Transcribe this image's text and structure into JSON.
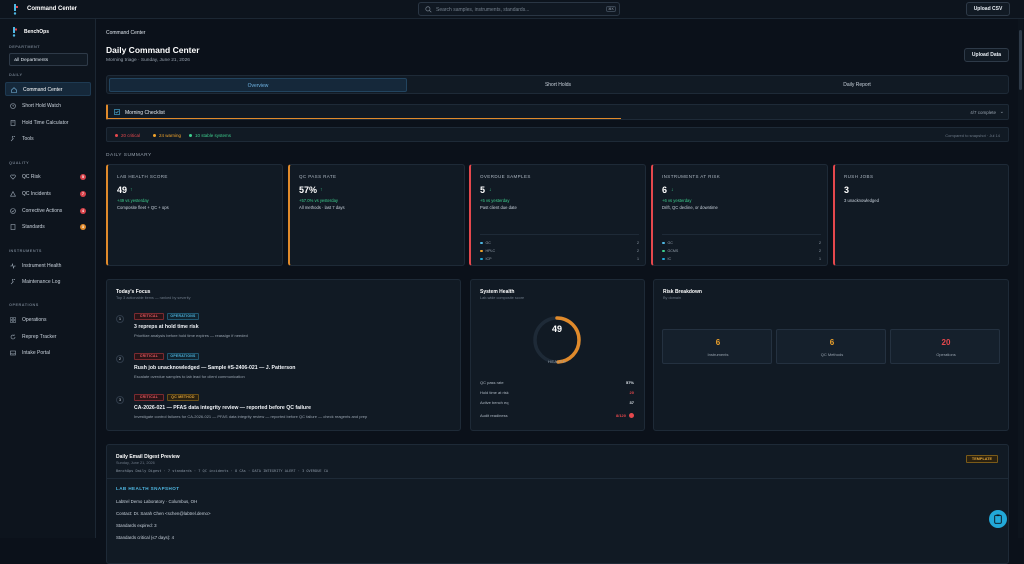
{
  "app": {
    "title": "Command Center",
    "brand": "BenchOps"
  },
  "search": {
    "placeholder": "Search samples, instruments, standards...",
    "shortcut": "⌘K"
  },
  "topbar": {
    "upload_csv": "Upload CSV"
  },
  "sidebar": {
    "department_label": "DEPARTMENT",
    "department_value": "All Departments",
    "sections": {
      "daily": "DAILY",
      "quality": "QUALITY",
      "instruments": "INSTRUMENTS",
      "operations": "OPERATIONS"
    },
    "daily_items": [
      {
        "label": "Command Center",
        "icon": "home-icon",
        "active": true
      },
      {
        "label": "Short Hold Watch",
        "icon": "clock-icon"
      },
      {
        "label": "Hold Time Calculator",
        "icon": "calculator-icon"
      },
      {
        "label": "Tools",
        "icon": "wrench-icon"
      }
    ],
    "quality_items": [
      {
        "label": "QC Risk",
        "icon": "heart-icon",
        "badge": "5",
        "badge_color": "#d8434b"
      },
      {
        "label": "QC Incidents",
        "icon": "alert-icon",
        "badge": "7",
        "badge_color": "#d8434b"
      },
      {
        "label": "Corrective Actions",
        "icon": "check-circle-icon",
        "badge": "4",
        "badge_color": "#d8434b"
      },
      {
        "label": "Standards",
        "icon": "document-icon",
        "badge": "3",
        "badge_color": "#e08a2b"
      }
    ],
    "instrument_items": [
      {
        "label": "Instrument Health",
        "icon": "pulse-icon"
      },
      {
        "label": "Maintenance Log",
        "icon": "wrench-icon"
      }
    ],
    "operation_items": [
      {
        "label": "Operations",
        "icon": "grid-icon"
      },
      {
        "label": "Reprep Tracker",
        "icon": "refresh-icon"
      },
      {
        "label": "Intake Portal",
        "icon": "inbox-icon"
      }
    ]
  },
  "main": {
    "breadcrumb": "Command Center",
    "title": "Daily Command Center",
    "subtitle": "Morning triage · Sunday, June 21, 2026",
    "upload_data": "Upload Data",
    "tabs": [
      {
        "label": "Overview",
        "active": true
      },
      {
        "label": "Short Holds"
      },
      {
        "label": "Daily Report"
      }
    ],
    "checklist": {
      "label": "Morning Checklist",
      "count": "4/7 complete",
      "progress": 0.57
    },
    "status": {
      "critical": "20 critical",
      "warning": "24 warning",
      "stable": "10 stable systems",
      "compare": "Compared to snapshot · Jul 14"
    },
    "colors": {
      "critical": "#e5484d",
      "warning": "#f0a32b",
      "stable": "#3ecf8e",
      "accent": "#22a8d8"
    },
    "summary_label": "DAILY SUMMARY"
  },
  "kpis": [
    {
      "title": "LAB HEALTH SCORE",
      "value": "49",
      "trend": "↑",
      "trend_color": "#3ecf8e",
      "delta": "+49 vs yesterday",
      "note": "Composite fleet + QC + ops",
      "accent": "#e08a2b",
      "rows": []
    },
    {
      "title": "QC PASS RATE",
      "value": "57%",
      "trend": "↑",
      "trend_color": "#3ecf8e",
      "delta": "+57.0% vs yesterday",
      "note": "All methods · last 7 days",
      "accent": "#e08a2b",
      "rows": []
    },
    {
      "title": "OVERDUE SAMPLES",
      "value": "5",
      "trend": "↓",
      "trend_color": "#3ecf8e",
      "delta": "+5 vs yesterday",
      "note": "Past client due date",
      "accent": "#e5484d",
      "rows": [
        {
          "label": "GC",
          "value": "2",
          "color": "#4fb8e3"
        },
        {
          "label": "HPLC",
          "value": "2",
          "color": "#f0a32b"
        },
        {
          "label": "ICP",
          "value": "1",
          "color": "#22a8d8"
        }
      ]
    },
    {
      "title": "INSTRUMENTS AT RISK",
      "value": "6",
      "trend": "↓",
      "trend_color": "#3ecf8e",
      "delta": "+6 vs yesterday",
      "note": "Drift, QC decline, or downtime",
      "accent": "#e5484d",
      "rows": [
        {
          "label": "GC",
          "value": "2",
          "color": "#4fb8e3"
        },
        {
          "label": "GCMS",
          "value": "2",
          "color": "#3ecf8e"
        },
        {
          "label": "IC",
          "value": "1",
          "color": "#22a8d8"
        },
        {
          "label": "ICP",
          "value": "1",
          "color": "#f0a32b"
        },
        {
          "label": "TPHD",
          "value": "1",
          "color": "#22a8d8"
        }
      ]
    },
    {
      "title": "RUSH JOBS",
      "value": "3",
      "trend": "",
      "trend_color": "#3ecf8e",
      "delta": "",
      "note": "3 unacknowledged",
      "accent": "#e5484d",
      "rows": []
    }
  ],
  "focus": {
    "title": "Today's Focus",
    "subtitle": "Top 3 actionable items — ranked by severity",
    "items": [
      {
        "num": "1",
        "tags": [
          {
            "label": "CRITICAL",
            "kind": "crit"
          },
          {
            "label": "OPERATIONS",
            "kind": "ops"
          }
        ],
        "title": "3 repreps at hold time risk",
        "desc": "Prioritize analysis before hold time expires — reassign if needed"
      },
      {
        "num": "2",
        "tags": [
          {
            "label": "CRITICAL",
            "kind": "crit"
          },
          {
            "label": "OPERATIONS",
            "kind": "ops"
          }
        ],
        "title": "Rush job unacknowledged — Sample #S-2406-021 — J. Patterson",
        "desc": "Escalate overdue samples to lab lead for client communication"
      },
      {
        "num": "3",
        "tags": [
          {
            "label": "CRITICAL",
            "kind": "crit"
          },
          {
            "label": "QC METHOD",
            "kind": "qc"
          }
        ],
        "title": "CA-2026-021 — PFAS data integrity review — reported before QC failure",
        "desc": "Investigate control failures for CA-2026-021 — PFAS data integrity review — reported before QC failure — check reagents and prep"
      }
    ]
  },
  "system_health": {
    "title": "System Health",
    "subtitle": "Lab-wide composite score",
    "score": "49",
    "score_fraction": 0.49,
    "label": "HEALTH",
    "rows": [
      {
        "label": "QC pass rate",
        "value": "57%",
        "color": "#e6ecf2"
      },
      {
        "label": "Hold time at risk",
        "value": "20",
        "color": "#e5484d"
      },
      {
        "label": "Active bench eq",
        "value": "37",
        "color": "#e6ecf2"
      },
      {
        "label": "Audit readiness",
        "value": "8/120",
        "color": "#e5484d"
      }
    ]
  },
  "risk": {
    "title": "Risk Breakdown",
    "subtitle": "By domain",
    "boxes": [
      {
        "value": "6",
        "label": "Instruments",
        "color": "#f0a32b"
      },
      {
        "value": "6",
        "label": "QC Methods",
        "color": "#f0a32b"
      },
      {
        "value": "20",
        "label": "Operations",
        "color": "#e5484d"
      }
    ]
  },
  "digest": {
    "title": "Daily Email Digest Preview",
    "date": "Sunday, June 21, 2026",
    "tag": "TEMPLATE",
    "summary_line": "BenchOps Daily Digest · 7 standards · 7 QC incidents · 8 CAs · DATA INTEGRITY ALERT · 3 OVERDUE CA",
    "section": "LAB HEALTH SNAPSHOT",
    "lines": [
      "Labtrel Demo Laboratory · Columbus, OH",
      "Contact: Dr. Sarah Chen <schen@labtrel.demo>",
      "Standards expired: 3",
      "Standards critical (≤7 days): 4"
    ]
  }
}
